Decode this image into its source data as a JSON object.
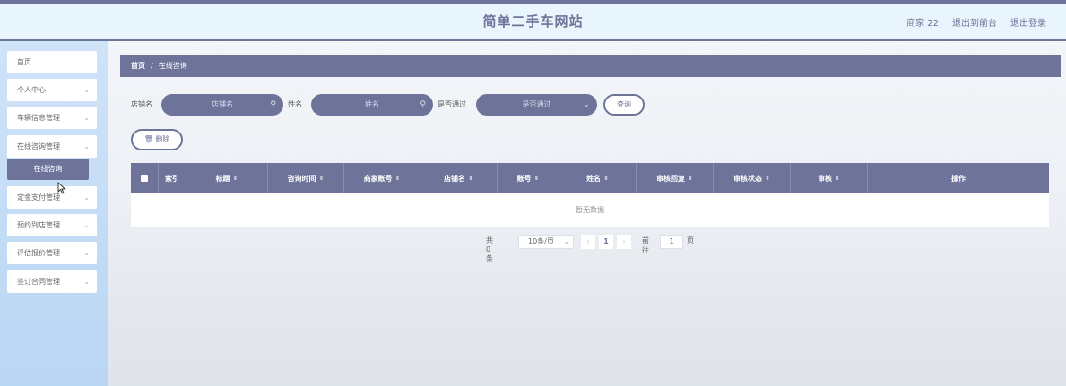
{
  "header": {
    "title": "简单二手车网站",
    "user": "商家 22",
    "front_link": "退出到前台",
    "logout_link": "退出登录"
  },
  "sidebar": {
    "items": [
      {
        "label": "首页",
        "has_arrow": false
      },
      {
        "label": "个人中心",
        "has_arrow": true
      },
      {
        "label": "车辆信息管理",
        "has_arrow": true
      },
      {
        "label": "在线咨询管理",
        "has_arrow": true
      },
      {
        "label": "定金支付管理",
        "has_arrow": true
      },
      {
        "label": "预约到店管理",
        "has_arrow": true
      },
      {
        "label": "评估报价管理",
        "has_arrow": true
      },
      {
        "label": "签订合同管理",
        "has_arrow": true
      }
    ],
    "active_sub": "在线咨询"
  },
  "breadcrumb": {
    "home": "首页",
    "sep": "/",
    "current": "在线咨询"
  },
  "search": {
    "shop_label": "店铺名",
    "shop_placeholder": "店铺名",
    "name_label": "姓名",
    "name_placeholder": "姓名",
    "pass_label": "是否通过",
    "pass_placeholder": "是否通过",
    "query_button": "查询"
  },
  "actions": {
    "delete_button": "删除"
  },
  "table": {
    "columns": [
      {
        "label": "索引",
        "sortable": false
      },
      {
        "label": "标题",
        "sortable": true
      },
      {
        "label": "咨询时间",
        "sortable": true
      },
      {
        "label": "商家账号",
        "sortable": true
      },
      {
        "label": "店铺名",
        "sortable": true
      },
      {
        "label": "账号",
        "sortable": true
      },
      {
        "label": "姓名",
        "sortable": true
      },
      {
        "label": "审核回复",
        "sortable": true
      },
      {
        "label": "审核状态",
        "sortable": true
      },
      {
        "label": "审核",
        "sortable": true
      },
      {
        "label": "操作",
        "sortable": false
      }
    ],
    "empty_text": "暂无数据"
  },
  "pagination": {
    "total": "共 0 条",
    "page_size": "10条/页",
    "current_page": "1",
    "goto_label": "前往",
    "goto_value": "1",
    "page_unit": "页"
  },
  "colors": {
    "accent": "#6e7399",
    "sidebar_bg": "#c4dcf5",
    "header_bg": "#e9f5fd"
  },
  "icons": [
    "search-icon",
    "chevron-down-icon",
    "trash-icon",
    "sort-icon",
    "chevron-left-icon",
    "chevron-right-icon"
  ]
}
